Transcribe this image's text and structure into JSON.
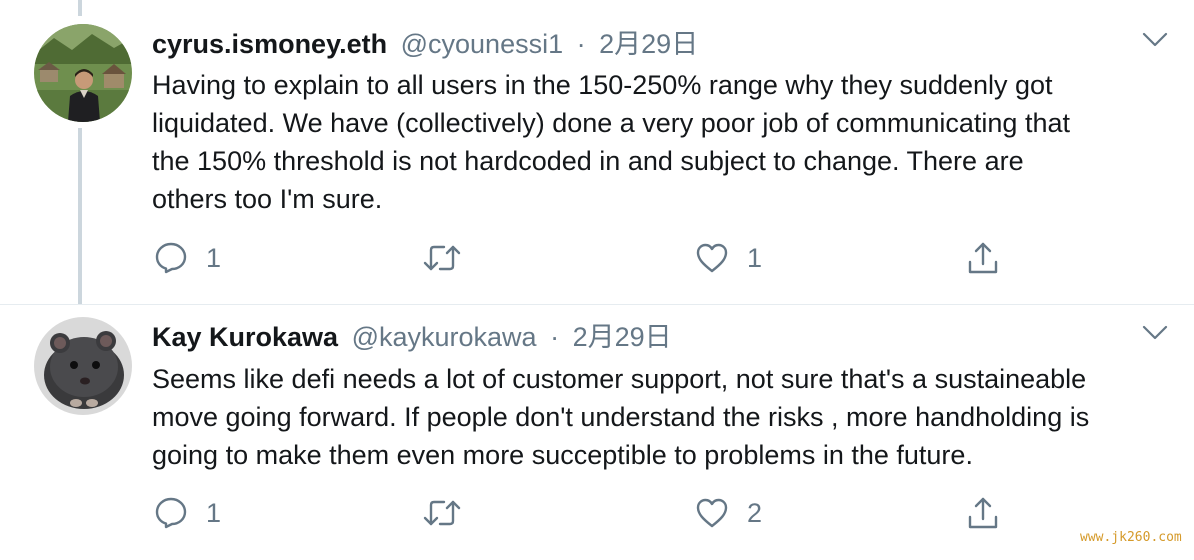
{
  "tweets": [
    {
      "display_name": "cyrus.ismoney.eth",
      "handle": "@cyounessi1",
      "separator": "·",
      "date": "2月29日",
      "text_lines": [
        "Having to explain to all users in the 150-250% range why they suddenly got",
        "liquidated. We have (collectively) done a very poor job of communicating that",
        "the 150% threshold is not hardcoded in and subject to change. There are",
        "others too I'm sure."
      ],
      "reply_count": "1",
      "retweet_count": "",
      "like_count": "1"
    },
    {
      "display_name": "Kay Kurokawa",
      "handle": "@kaykurokawa",
      "separator": "·",
      "date": "2月29日",
      "text_lines": [
        "Seems like defi needs a lot of customer support, not sure that's a sustaineable",
        "move going forward. If people don't understand the risks , more handholding is",
        "going to make them even more succeptible to problems in the future."
      ],
      "reply_count": "1",
      "retweet_count": "",
      "like_count": "2"
    }
  ],
  "watermark": "www.jk260.com",
  "icons": {
    "reply": "reply-icon",
    "retweet": "retweet-icon",
    "like": "like-icon",
    "share": "share-icon",
    "more": "chevron-down-icon"
  },
  "colors": {
    "text": "#14171a",
    "secondary": "#657786",
    "thread_line": "#ccd6dd",
    "divider": "#e6ecf0"
  }
}
